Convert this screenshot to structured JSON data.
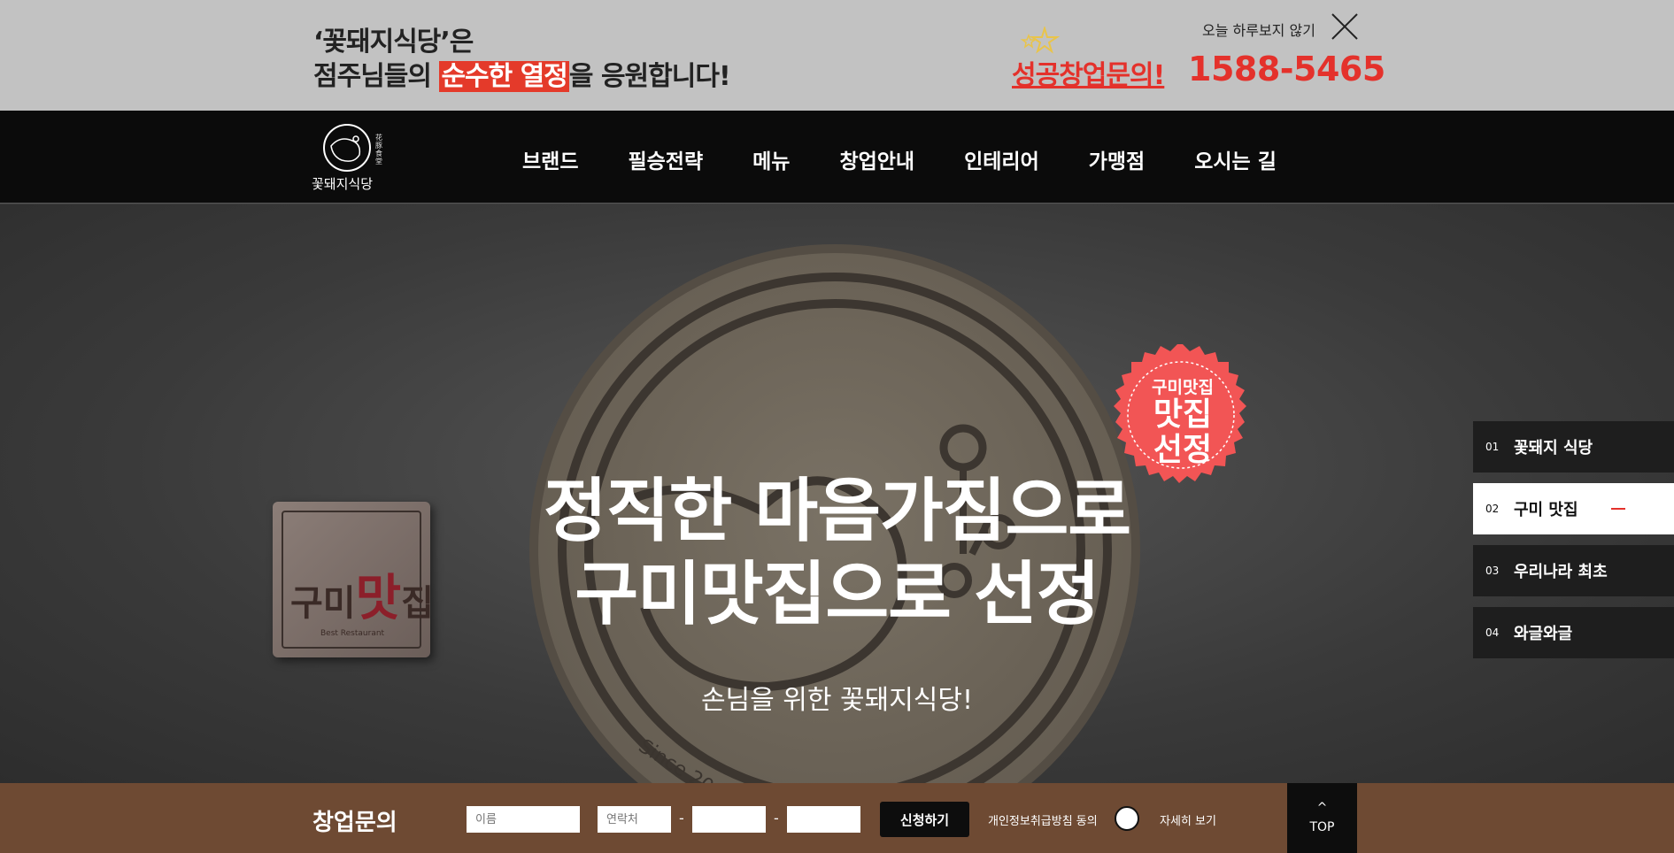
{
  "promo": {
    "line1": "‘꽃돼지식당’은",
    "line2_pre": "점주님들의 ",
    "line2_highlight": "순수한 열정",
    "line2_post": "을 응원합니다!",
    "cta": "성공창업문의!",
    "phone": "1588-5465",
    "hide_today": "오늘 하루보지 않기"
  },
  "nav": {
    "logo_text": "꽃돼지식당",
    "logo_hanja": "花豚食堂",
    "menu": [
      "브랜드",
      "필승전략",
      "메뉴",
      "창업안내",
      "인테리어",
      "가맹점",
      "오시는 길"
    ]
  },
  "hero": {
    "title_line1": "정직한 마음가짐으로",
    "title_line2": "구미맛집으로 선정",
    "subtitle": "손님을 위한 꽃돼지식당!",
    "since": "Since 2019",
    "badge_top": "구미맛집",
    "badge_line1": "맛집",
    "badge_line2": "선정",
    "sign_text_pre": "구미",
    "sign_text_red": "맛",
    "sign_text_post": "집",
    "sign_sub": "Best Restaurant"
  },
  "side_indicators": [
    {
      "num": "01",
      "label": "꽃돼지 식당",
      "active": false
    },
    {
      "num": "02",
      "label": "구미 맛집",
      "active": true
    },
    {
      "num": "03",
      "label": "우리나라 최초",
      "active": false
    },
    {
      "num": "04",
      "label": "와글와글",
      "active": false
    }
  ],
  "inquiry": {
    "title": "창업문의",
    "name_placeholder": "이름",
    "phone_placeholder": "연락처",
    "dash": "-",
    "submit": "신청하기",
    "privacy": "개인정보취급방침 동의",
    "detail": "자세히 보기",
    "top_arrow": "^",
    "top_label": "TOP"
  },
  "colors": {
    "accent_red": "#e4312b",
    "inquiry_brown": "#6e4a33",
    "promo_gray": "#c2c2c2",
    "nav_black": "#0b0b0b"
  }
}
